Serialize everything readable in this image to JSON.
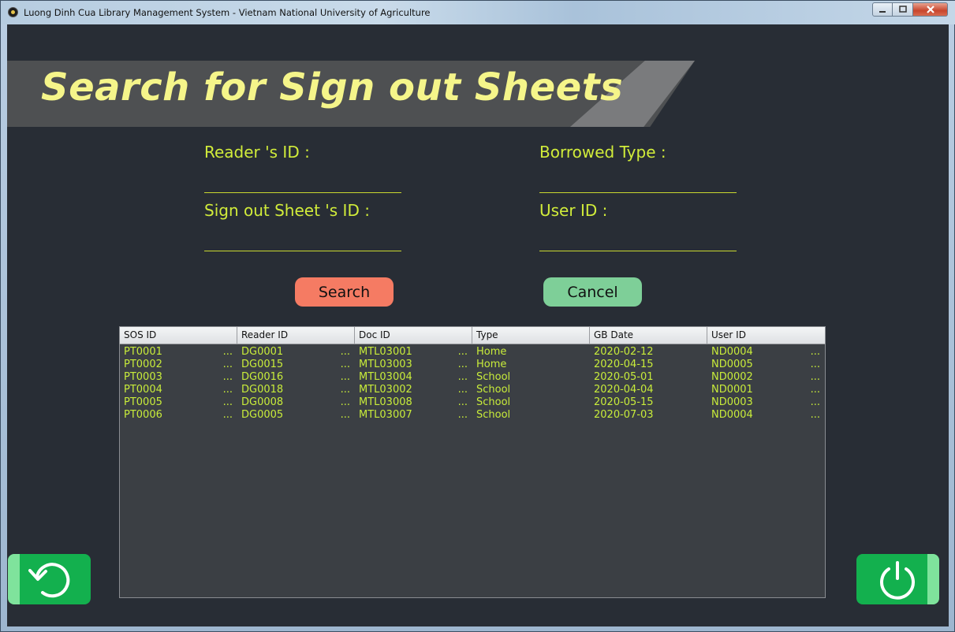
{
  "window": {
    "title": "Luong Dinh Cua Library Management System - Vietnam National University of Agriculture",
    "minimize_icon": "minimize-icon",
    "maximize_icon": "maximize-icon",
    "close_icon": "close-icon"
  },
  "banner": {
    "title": "Search for Sign out Sheets"
  },
  "form": {
    "reader_id_label": "Reader 's ID :",
    "reader_id_value": "",
    "borrowed_type_label": "Borrowed Type :",
    "borrowed_type_value": "",
    "sign_out_sheet_id_label": "Sign out Sheet 's ID :",
    "sign_out_sheet_id_value": "",
    "user_id_label": "User ID :",
    "user_id_value": ""
  },
  "buttons": {
    "search_label": "Search",
    "cancel_label": "Cancel",
    "back_icon": "undo-icon",
    "exit_icon": "power-icon"
  },
  "colors": {
    "background": "#282d35",
    "label": "#d1ec3a",
    "title": "#f5f58a",
    "search_button": "#f57b63",
    "cancel_button": "#7ecf98",
    "nav_button": "#13b04e"
  },
  "table": {
    "columns": [
      "SOS ID",
      "Reader ID",
      "Doc ID",
      "Type",
      "GB Date",
      "User ID"
    ],
    "rows": [
      [
        "PT0001",
        "DG0001",
        "MTL03001",
        "Home",
        "2020-02-12",
        "ND0004"
      ],
      [
        "PT0002",
        "DG0015",
        "MTL03003",
        "Home",
        "2020-04-15",
        "ND0005"
      ],
      [
        "PT0003",
        "DG0016",
        "MTL03004",
        "School",
        "2020-05-01",
        "ND0002"
      ],
      [
        "PT0004",
        "DG0018",
        "MTL03002",
        "School",
        "2020-04-04",
        "ND0001"
      ],
      [
        "PT0005",
        "DG0008",
        "MTL03008",
        "School",
        "2020-05-15",
        "ND0003"
      ],
      [
        "PT0006",
        "DG0005",
        "MTL03007",
        "School",
        "2020-07-03",
        "ND0004"
      ]
    ],
    "ellipsis": "..."
  }
}
